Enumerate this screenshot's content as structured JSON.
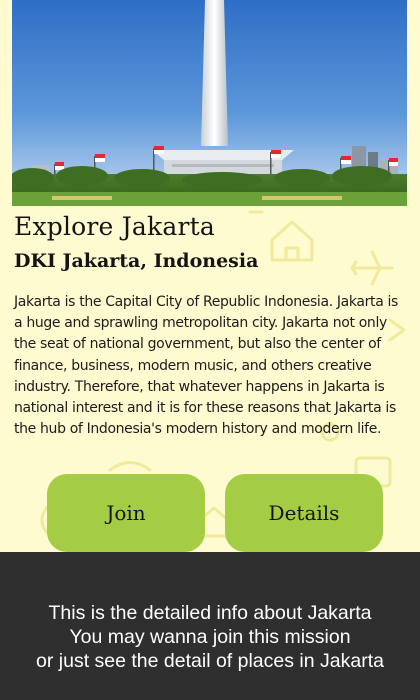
{
  "place": {
    "title": "Explore Jakarta",
    "location": "DKI Jakarta, Indonesia",
    "description": "Jakarta is the Capital City of Republic Indonesia. Jakarta is a huge and sprawling metropolitan city. Jakarta not only the seat of national government, but also the center of finance, business, modern music, and others creative industry. Therefore, that whatever happens in Jakarta is national interest and it is for these reasons that Jakarta is the hub of Indonesia's modern history and modern life.",
    "image_icon": "monas-national-monument-photo"
  },
  "actions": {
    "join_label": "Join",
    "details_label": "Details"
  },
  "info_banner": {
    "lines": [
      "This is the detailed info about Jakarta",
      "You may wanna join this mission",
      "or just see the detail of places in Jakarta"
    ]
  },
  "colors": {
    "card_background": "#fffbd0",
    "button_background": "#a4cc44",
    "banner_background": "#2f2f2f",
    "banner_text": "#ffffff"
  }
}
